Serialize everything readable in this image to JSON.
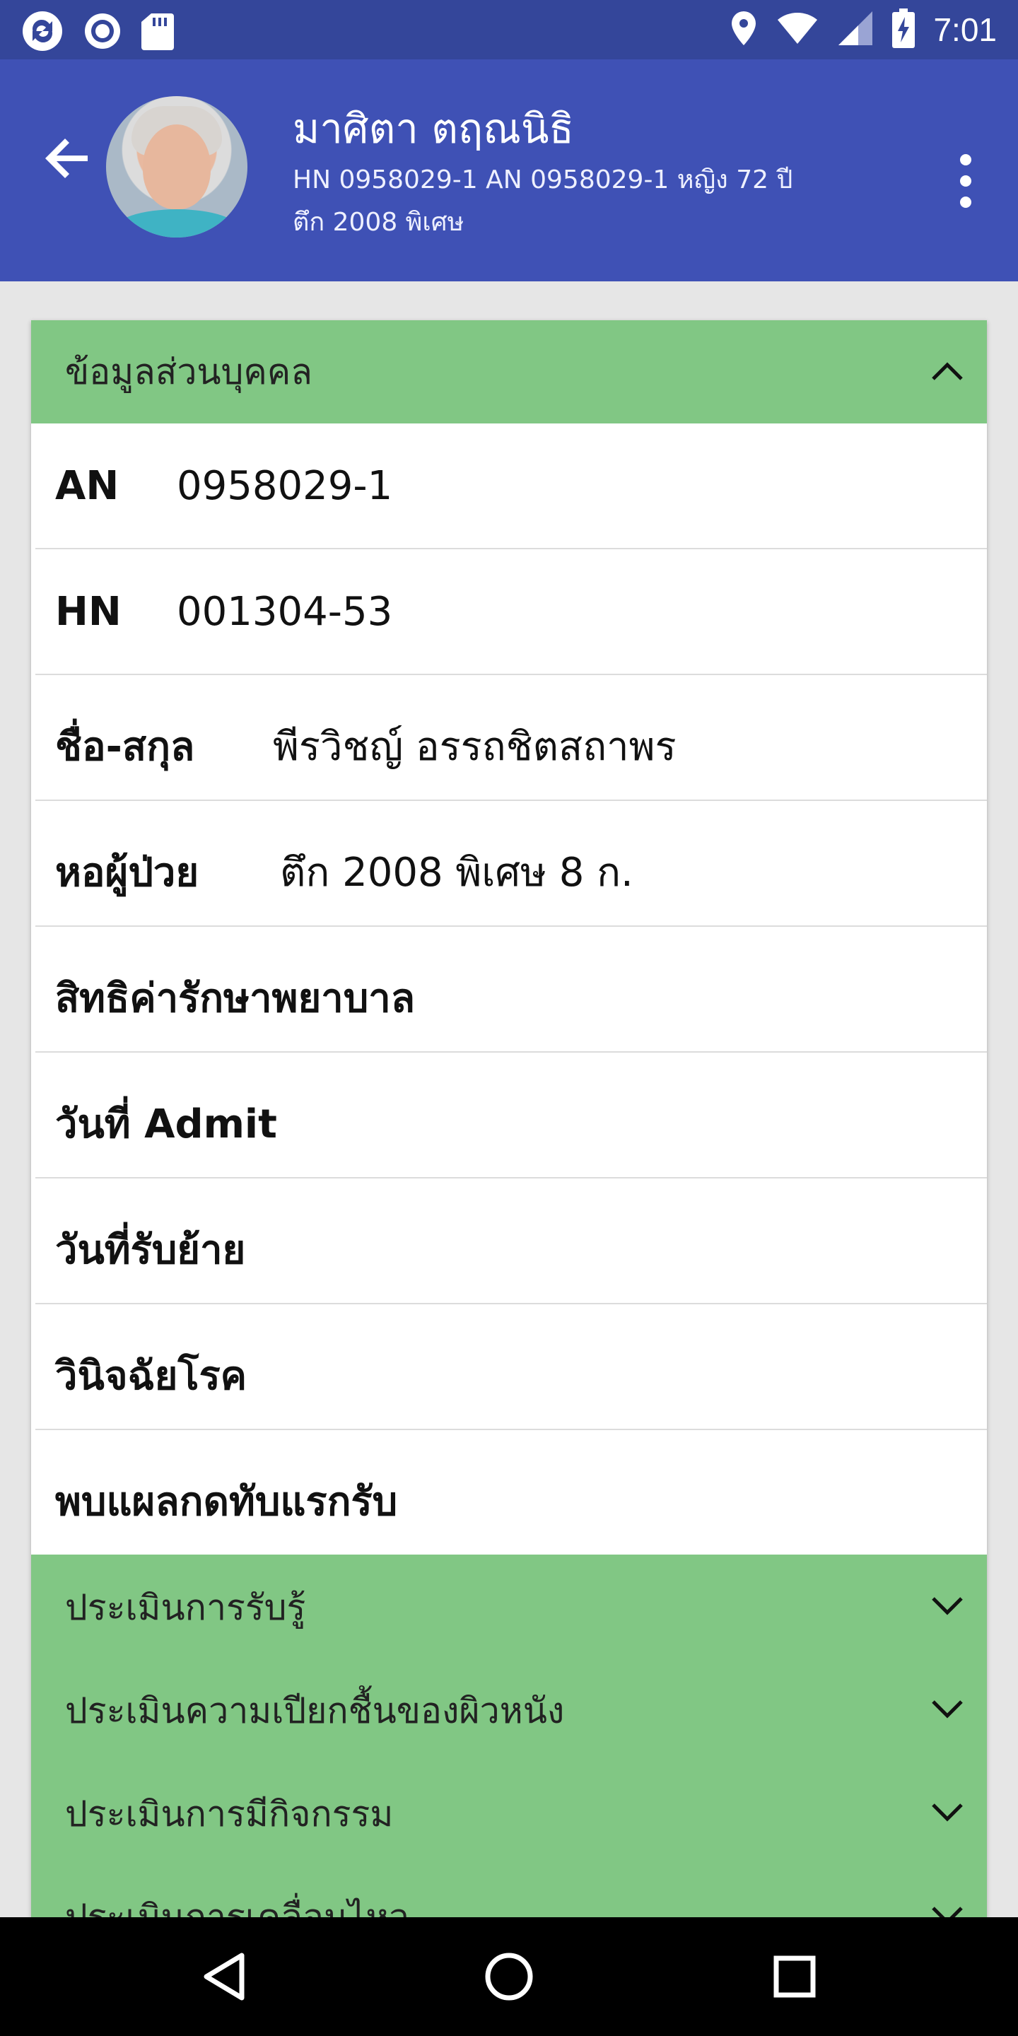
{
  "status_bar": {
    "time": "7:01",
    "left_icons": [
      "sync-icon",
      "record-icon",
      "sd-card-icon"
    ],
    "right_icons": [
      "location-icon",
      "wifi-icon",
      "cell-signal-icon",
      "battery-charging-icon"
    ]
  },
  "app_bar": {
    "patient_name": "มาศิตา ตฤณนิธิ",
    "info_line": "HN 0958029-1  AN 0958029-1 หญิง 72 ปี",
    "ward_line": "ตึก 2008 พิเศษ"
  },
  "personal_section": {
    "title": "ข้อมูลส่วนบุคคล",
    "rows": [
      {
        "label": "AN",
        "value": "0958029-1"
      },
      {
        "label": "HN",
        "value": "001304-53"
      },
      {
        "label": "ชื่อ-สกุล",
        "value": "พีรวิชญ์ อรรถชิตสถาพร"
      },
      {
        "label": "หอผู้ป่วย",
        "value": "ตึก 2008 พิเศษ 8 ก."
      },
      {
        "label": "สิทธิค่ารักษาพยาบาล",
        "value": ""
      },
      {
        "label": "วันที่ Admit",
        "value": ""
      },
      {
        "label": "วันที่รับย้าย",
        "value": ""
      },
      {
        "label": "วินิจฉัยโรค",
        "value": ""
      },
      {
        "label": "พบแผลกดทับแรกรับ",
        "value": ""
      }
    ]
  },
  "assessment_sections": [
    {
      "title": "ประเมินการรับรู้"
    },
    {
      "title": "ประเมินความเปียกชื้นของผิวหนัง"
    },
    {
      "title": "ประเมินการมีกิจกรรม"
    },
    {
      "title": "ประเมินการเคลื่อนไหว"
    }
  ],
  "colors": {
    "status_bar": "#34469a",
    "app_bar": "#3f51b5",
    "section_header": "#81c784",
    "background": "#e6e6e6",
    "nav_bar": "#000000"
  },
  "nav_bar": {
    "buttons": [
      "back-triangle-icon",
      "home-circle-icon",
      "recents-square-icon"
    ]
  }
}
